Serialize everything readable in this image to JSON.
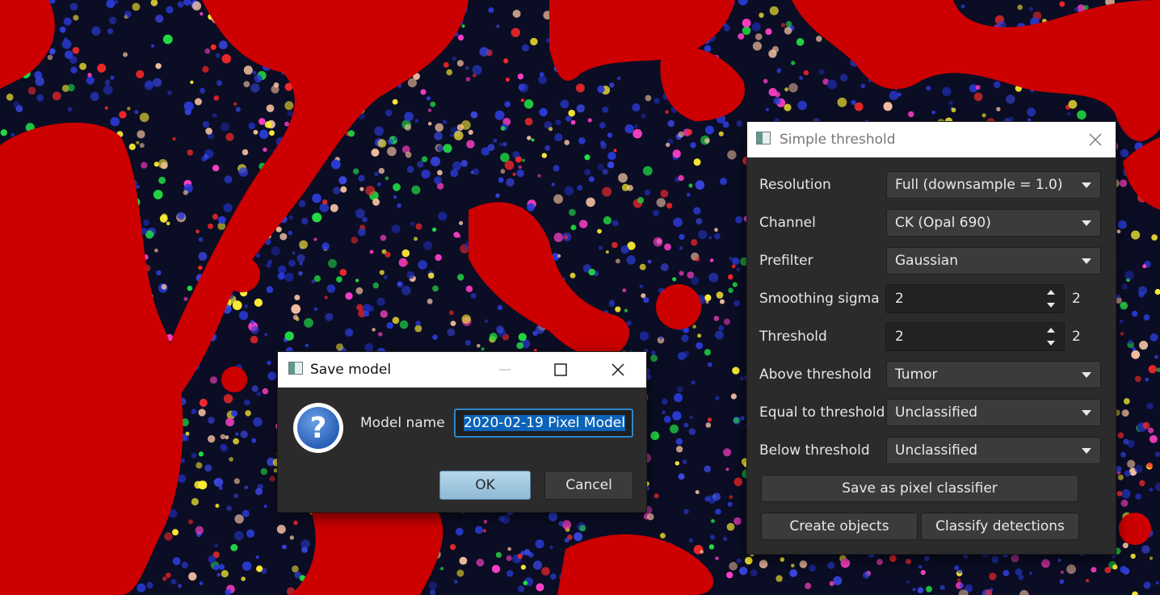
{
  "background": {
    "description_colors": {
      "tissue_dark": "#0b0d24",
      "nuclei": "#2233cc",
      "overlay": "#cc0000"
    }
  },
  "simple_threshold": {
    "title": "Simple threshold",
    "rows": {
      "resolution": {
        "label": "Resolution",
        "value": "Full (downsample = 1.0)"
      },
      "channel": {
        "label": "Channel",
        "value": "CK (Opal 690)"
      },
      "prefilter": {
        "label": "Prefilter",
        "value": "Gaussian"
      },
      "smoothing_sigma": {
        "label": "Smoothing sigma",
        "value": "2",
        "readout": "2"
      },
      "threshold": {
        "label": "Threshold",
        "value": "2",
        "readout": "2"
      },
      "above": {
        "label": "Above threshold",
        "value": "Tumor"
      },
      "equal": {
        "label": "Equal to threshold",
        "value": "Unclassified"
      },
      "below": {
        "label": "Below threshold",
        "value": "Unclassified"
      }
    },
    "buttons": {
      "save_pixel_classifier": "Save as pixel classifier",
      "create_objects": "Create objects",
      "classify_detections": "Classify detections"
    }
  },
  "save_model": {
    "title": "Save model",
    "model_name_label": "Model name",
    "model_name_value": "2020-02-19 Pixel Model",
    "ok_label": "OK",
    "cancel_label": "Cancel"
  }
}
